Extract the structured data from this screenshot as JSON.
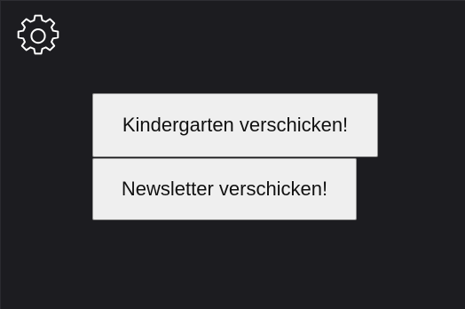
{
  "toolbar": {
    "settings_icon": "gear-icon",
    "icon_color": "#ffffff"
  },
  "actions": {
    "kindergarten_label": "Kindergarten verschicken!",
    "newsletter_label": "Newsletter verschicken!"
  },
  "colors": {
    "background": "#1c1c20",
    "button_background": "#efefef",
    "button_text": "#111111"
  }
}
